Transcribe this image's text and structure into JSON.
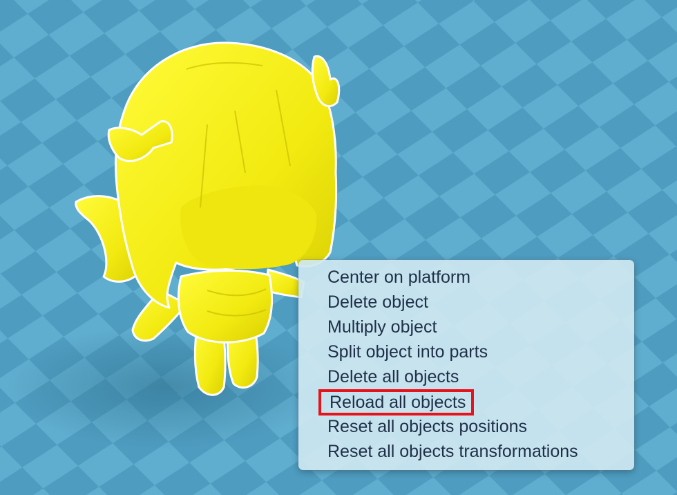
{
  "scene": {
    "object_color": "#f7f015",
    "platform_color_light": "#69b6d6",
    "platform_color_dark": "#4f9dc0"
  },
  "context_menu": {
    "items": [
      {
        "label": "Center on platform"
      },
      {
        "label": "Delete object"
      },
      {
        "label": "Multiply object"
      },
      {
        "label": "Split object into parts"
      },
      {
        "label": "Delete all objects"
      },
      {
        "label": "Reload all objects",
        "highlighted": true,
        "highlight_color": "#e8121b"
      },
      {
        "label": "Reset all objects positions"
      },
      {
        "label": "Reset all objects transformations"
      }
    ]
  }
}
